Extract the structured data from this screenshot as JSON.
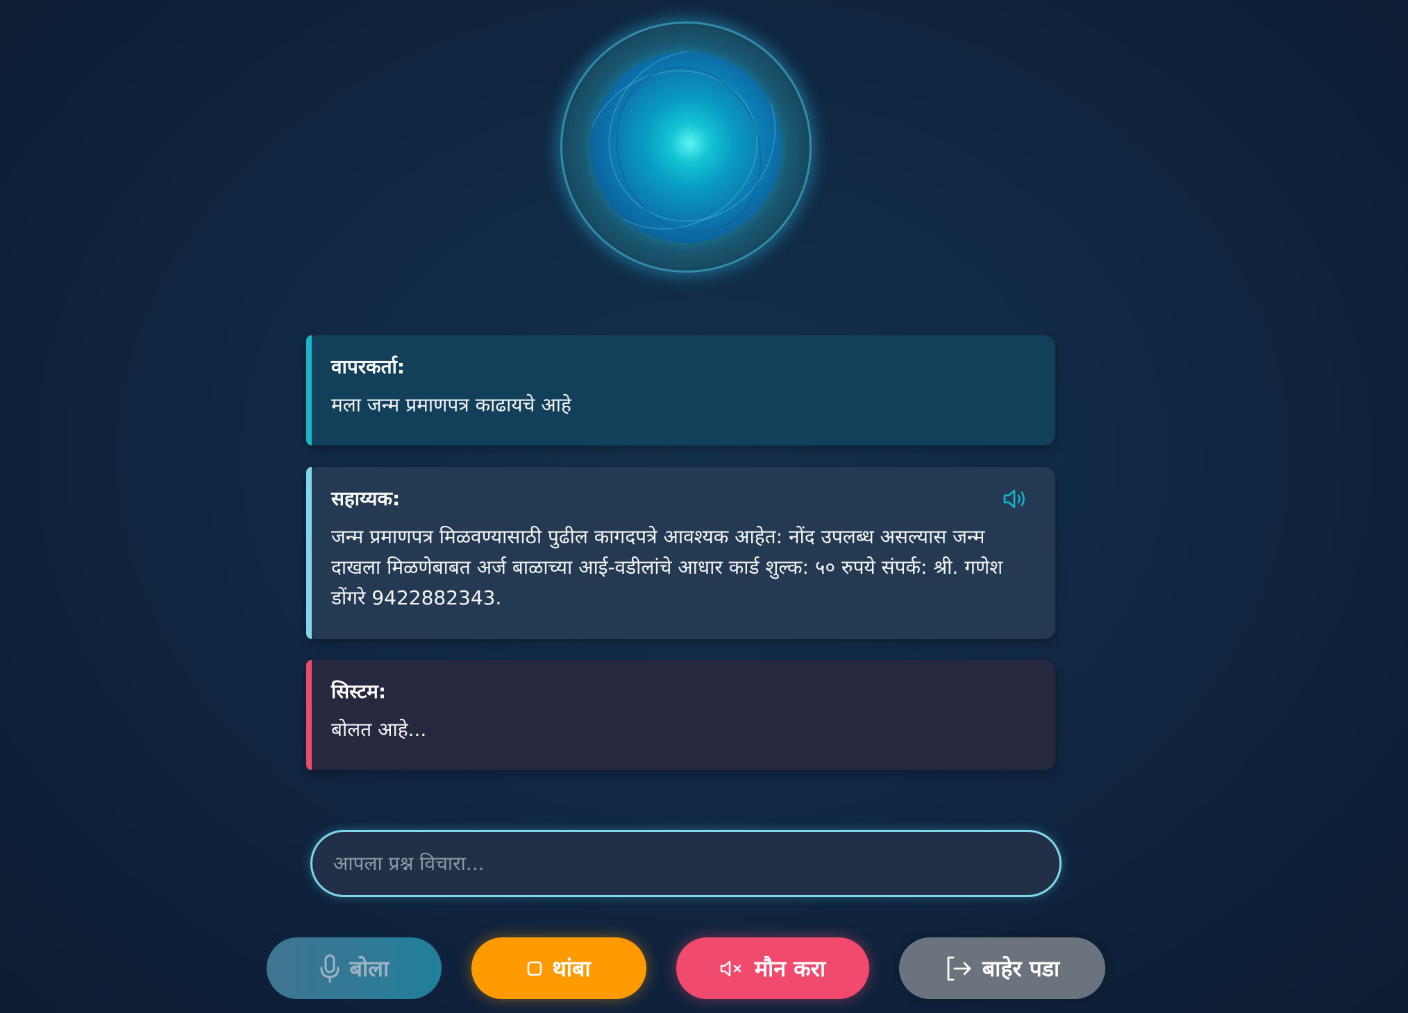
{
  "messages": {
    "user": {
      "label": "वापरकर्ता:",
      "text": "मला जन्म प्रमाणपत्र काढायचे आहे"
    },
    "assistant": {
      "label": "सहाय्यक:",
      "text": "जन्म प्रमाणपत्र मिळवण्यासाठी पुढील कागदपत्रे आवश्यक आहेत: नोंद उपलब्ध असल्यास जन्म दाखला मिळणेबाबत अर्ज बाळाच्या आई-वडीलांचे आधार कार्ड शुल्क: ५० रुपये संपर्क: श्री. गणेश डोंगरे 9422882343."
    },
    "system": {
      "label": "सिस्टम:",
      "text": "बोलत आहे..."
    }
  },
  "input": {
    "placeholder": "आपला प्रश्न विचारा...",
    "value": ""
  },
  "buttons": {
    "speak": "बोला",
    "stop": "थांबा",
    "mute": "मौन करा",
    "exit": "बाहेर पडा"
  },
  "icons": {
    "speaker": "speaker-icon",
    "mic": "microphone-icon",
    "stop": "stop-square-icon",
    "mute": "mute-icon",
    "exit": "logout-icon"
  },
  "colors": {
    "background": "#112a45",
    "user_accent": "#18b6cc",
    "assistant_accent": "#7fd8ea",
    "system_accent": "#ec4b6a",
    "stop_button": "#ff9a00",
    "mute_button": "#f04a6d",
    "exit_button": "#6b737f",
    "speak_button": "#2f7a96"
  }
}
